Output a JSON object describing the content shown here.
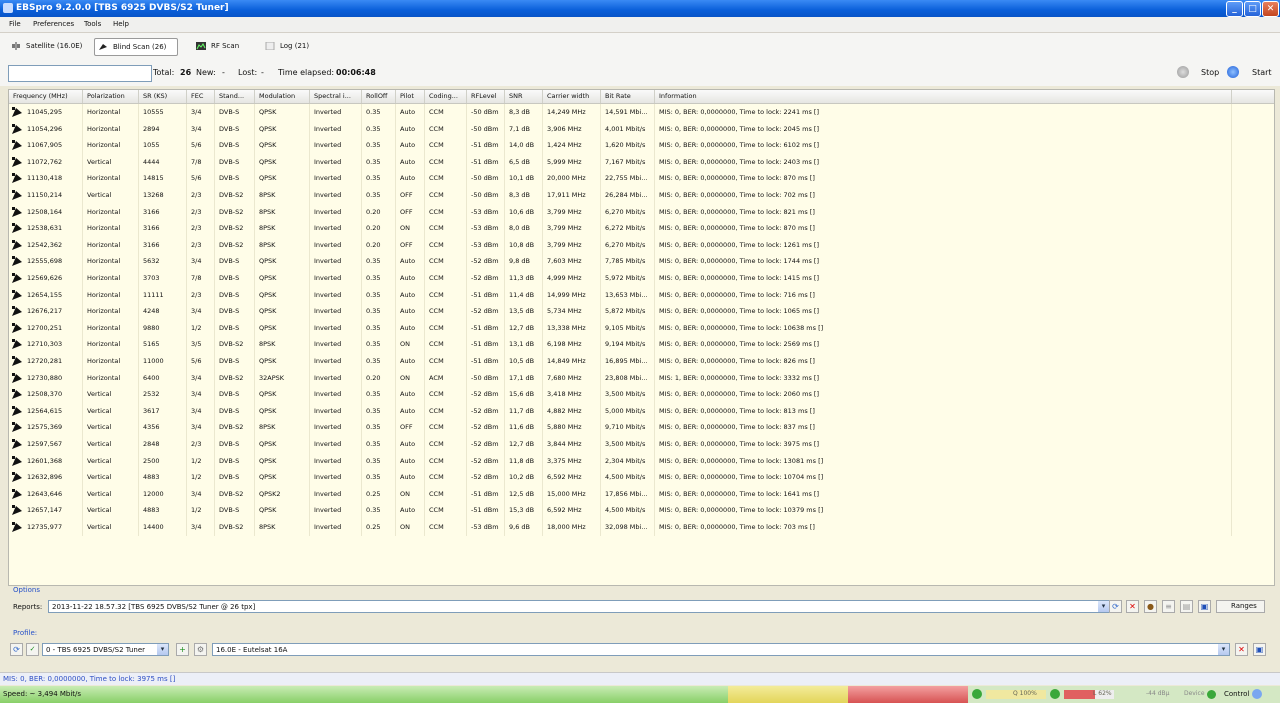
{
  "window": {
    "title": "EBSpro 9.2.0.0 [TBS 6925 DVBS/S2 Tuner]",
    "minimize": "_",
    "maximize": "□",
    "close": "✕"
  },
  "menu": [
    "File",
    "Preferences",
    "Tools",
    "Help"
  ],
  "tabs": [
    {
      "label": "Satellite (16.0E)"
    },
    {
      "label": "Blind Scan (26)"
    },
    {
      "label": "RF Scan"
    },
    {
      "label": "Log (21)"
    }
  ],
  "status": {
    "search_value": "",
    "total_label": "Total:",
    "total_value": "26",
    "new_label": "New:",
    "new_value": "-",
    "lost_label": "Lost:",
    "lost_value": "-",
    "elapsed_label": "Time elapsed:",
    "elapsed_value": "00:06:48",
    "stop_label": "Stop",
    "start_label": "Start"
  },
  "table": {
    "columns": [
      "Frequency (MHz)",
      "Polarization",
      "SR (KS)",
      "FEC",
      "Stand...",
      "Modulation",
      "Spectral i...",
      "RollOff",
      "Pilot",
      "Coding...",
      "RFLevel",
      "SNR",
      "Carrier width",
      "Bit Rate",
      "Information"
    ],
    "rows": [
      [
        "11045,295",
        "Horizontal",
        "10555",
        "3/4",
        "DVB-S",
        "QPSK",
        "Inverted",
        "0.35",
        "Auto",
        "CCM",
        "-50 dBm",
        "8,3 dB",
        "14,249 MHz",
        "14,591 Mbi...",
        "MIS: 0, BER: 0,0000000, Time to lock: 2241 ms []"
      ],
      [
        "11054,296",
        "Horizontal",
        "2894",
        "3/4",
        "DVB-S",
        "QPSK",
        "Inverted",
        "0.35",
        "Auto",
        "CCM",
        "-50 dBm",
        "7,1 dB",
        "3,906 MHz",
        "4,001 Mbit/s",
        "MIS: 0, BER: 0,0000000, Time to lock: 2045 ms []"
      ],
      [
        "11067,905",
        "Horizontal",
        "1055",
        "5/6",
        "DVB-S",
        "QPSK",
        "Inverted",
        "0.35",
        "Auto",
        "CCM",
        "-51 dBm",
        "14,0 dB",
        "1,424 MHz",
        "1,620 Mbit/s",
        "MIS: 0, BER: 0,0000000, Time to lock: 6102 ms []"
      ],
      [
        "11072,762",
        "Vertical",
        "4444",
        "7/8",
        "DVB-S",
        "QPSK",
        "Inverted",
        "0.35",
        "Auto",
        "CCM",
        "-51 dBm",
        "6,5 dB",
        "5,999 MHz",
        "7,167 Mbit/s",
        "MIS: 0, BER: 0,0000000, Time to lock: 2403 ms []"
      ],
      [
        "11130,418",
        "Horizontal",
        "14815",
        "5/6",
        "DVB-S",
        "QPSK",
        "Inverted",
        "0.35",
        "Auto",
        "CCM",
        "-50 dBm",
        "10,1 dB",
        "20,000 MHz",
        "22,755 Mbi...",
        "MIS: 0, BER: 0,0000000, Time to lock: 870 ms []"
      ],
      [
        "11150,214",
        "Vertical",
        "13268",
        "2/3",
        "DVB-S2",
        "8PSK",
        "Inverted",
        "0.35",
        "OFF",
        "CCM",
        "-50 dBm",
        "8,3 dB",
        "17,911 MHz",
        "26,284 Mbi...",
        "MIS: 0, BER: 0,0000000, Time to lock: 702 ms []"
      ],
      [
        "12508,164",
        "Horizontal",
        "3166",
        "2/3",
        "DVB-S2",
        "8PSK",
        "Inverted",
        "0.20",
        "OFF",
        "CCM",
        "-53 dBm",
        "10,6 dB",
        "3,799 MHz",
        "6,270 Mbit/s",
        "MIS: 0, BER: 0,0000000, Time to lock: 821 ms []"
      ],
      [
        "12538,631",
        "Horizontal",
        "3166",
        "2/3",
        "DVB-S2",
        "8PSK",
        "Inverted",
        "0.20",
        "ON",
        "CCM",
        "-53 dBm",
        "8,0 dB",
        "3,799 MHz",
        "6,272 Mbit/s",
        "MIS: 0, BER: 0,0000000, Time to lock: 870 ms []"
      ],
      [
        "12542,362",
        "Horizontal",
        "3166",
        "2/3",
        "DVB-S2",
        "8PSK",
        "Inverted",
        "0.20",
        "OFF",
        "CCM",
        "-53 dBm",
        "10,8 dB",
        "3,799 MHz",
        "6,270 Mbit/s",
        "MIS: 0, BER: 0,0000000, Time to lock: 1261 ms []"
      ],
      [
        "12555,698",
        "Horizontal",
        "5632",
        "3/4",
        "DVB-S",
        "QPSK",
        "Inverted",
        "0.35",
        "Auto",
        "CCM",
        "-52 dBm",
        "9,8 dB",
        "7,603 MHz",
        "7,785 Mbit/s",
        "MIS: 0, BER: 0,0000000, Time to lock: 1744 ms []"
      ],
      [
        "12569,626",
        "Horizontal",
        "3703",
        "7/8",
        "DVB-S",
        "QPSK",
        "Inverted",
        "0.35",
        "Auto",
        "CCM",
        "-52 dBm",
        "11,3 dB",
        "4,999 MHz",
        "5,972 Mbit/s",
        "MIS: 0, BER: 0,0000000, Time to lock: 1415 ms []"
      ],
      [
        "12654,155",
        "Horizontal",
        "11111",
        "2/3",
        "DVB-S",
        "QPSK",
        "Inverted",
        "0.35",
        "Auto",
        "CCM",
        "-51 dBm",
        "11,4 dB",
        "14,999 MHz",
        "13,653 Mbi...",
        "MIS: 0, BER: 0,0000000, Time to lock: 716 ms []"
      ],
      [
        "12676,217",
        "Horizontal",
        "4248",
        "3/4",
        "DVB-S",
        "QPSK",
        "Inverted",
        "0.35",
        "Auto",
        "CCM",
        "-52 dBm",
        "13,5 dB",
        "5,734 MHz",
        "5,872 Mbit/s",
        "MIS: 0, BER: 0,0000000, Time to lock: 1065 ms []"
      ],
      [
        "12700,251",
        "Horizontal",
        "9880",
        "1/2",
        "DVB-S",
        "QPSK",
        "Inverted",
        "0.35",
        "Auto",
        "CCM",
        "-51 dBm",
        "12,7 dB",
        "13,338 MHz",
        "9,105 Mbit/s",
        "MIS: 0, BER: 0,0000000, Time to lock: 10638 ms []"
      ],
      [
        "12710,303",
        "Horizontal",
        "5165",
        "3/5",
        "DVB-S2",
        "8PSK",
        "Inverted",
        "0.35",
        "ON",
        "CCM",
        "-51 dBm",
        "13,1 dB",
        "6,198 MHz",
        "9,194 Mbit/s",
        "MIS: 0, BER: 0,0000000, Time to lock: 2569 ms []"
      ],
      [
        "12720,281",
        "Horizontal",
        "11000",
        "5/6",
        "DVB-S",
        "QPSK",
        "Inverted",
        "0.35",
        "Auto",
        "CCM",
        "-51 dBm",
        "10,5 dB",
        "14,849 MHz",
        "16,895 Mbi...",
        "MIS: 0, BER: 0,0000000, Time to lock: 826 ms []"
      ],
      [
        "12730,880",
        "Horizontal",
        "6400",
        "3/4",
        "DVB-S2",
        "32APSK",
        "Inverted",
        "0.20",
        "ON",
        "ACM",
        "-50 dBm",
        "17,1 dB",
        "7,680 MHz",
        "23,808 Mbi...",
        "MIS: 1, BER: 0,0000000, Time to lock: 3332 ms []"
      ],
      [
        "12508,370",
        "Vertical",
        "2532",
        "3/4",
        "DVB-S",
        "QPSK",
        "Inverted",
        "0.35",
        "Auto",
        "CCM",
        "-52 dBm",
        "15,6 dB",
        "3,418 MHz",
        "3,500 Mbit/s",
        "MIS: 0, BER: 0,0000000, Time to lock: 2060 ms []"
      ],
      [
        "12564,615",
        "Vertical",
        "3617",
        "3/4",
        "DVB-S",
        "QPSK",
        "Inverted",
        "0.35",
        "Auto",
        "CCM",
        "-52 dBm",
        "11,7 dB",
        "4,882 MHz",
        "5,000 Mbit/s",
        "MIS: 0, BER: 0,0000000, Time to lock: 813 ms []"
      ],
      [
        "12575,369",
        "Vertical",
        "4356",
        "3/4",
        "DVB-S2",
        "8PSK",
        "Inverted",
        "0.35",
        "OFF",
        "CCM",
        "-52 dBm",
        "11,6 dB",
        "5,880 MHz",
        "9,710 Mbit/s",
        "MIS: 0, BER: 0,0000000, Time to lock: 837 ms []"
      ],
      [
        "12597,567",
        "Vertical",
        "2848",
        "2/3",
        "DVB-S",
        "QPSK",
        "Inverted",
        "0.35",
        "Auto",
        "CCM",
        "-52 dBm",
        "12,7 dB",
        "3,844 MHz",
        "3,500 Mbit/s",
        "MIS: 0, BER: 0,0000000, Time to lock: 3975 ms []"
      ],
      [
        "12601,368",
        "Vertical",
        "2500",
        "1/2",
        "DVB-S",
        "QPSK",
        "Inverted",
        "0.35",
        "Auto",
        "CCM",
        "-52 dBm",
        "11,8 dB",
        "3,375 MHz",
        "2,304 Mbit/s",
        "MIS: 0, BER: 0,0000000, Time to lock: 13081 ms []"
      ],
      [
        "12632,896",
        "Vertical",
        "4883",
        "1/2",
        "DVB-S",
        "QPSK",
        "Inverted",
        "0.35",
        "Auto",
        "CCM",
        "-52 dBm",
        "10,2 dB",
        "6,592 MHz",
        "4,500 Mbit/s",
        "MIS: 0, BER: 0,0000000, Time to lock: 10704 ms []"
      ],
      [
        "12643,646",
        "Vertical",
        "12000",
        "3/4",
        "DVB-S2",
        "QPSK2",
        "Inverted",
        "0.25",
        "ON",
        "CCM",
        "-51 dBm",
        "12,5 dB",
        "15,000 MHz",
        "17,856 Mbi...",
        "MIS: 0, BER: 0,0000000, Time to lock: 1641 ms []"
      ],
      [
        "12657,147",
        "Vertical",
        "4883",
        "1/2",
        "DVB-S",
        "QPSK",
        "Inverted",
        "0.35",
        "Auto",
        "CCM",
        "-51 dBm",
        "15,3 dB",
        "6,592 MHz",
        "4,500 Mbit/s",
        "MIS: 0, BER: 0,0000000, Time to lock: 10379 ms []"
      ],
      [
        "12735,977",
        "Vertical",
        "14400",
        "3/4",
        "DVB-S2",
        "8PSK",
        "Inverted",
        "0.25",
        "ON",
        "CCM",
        "-53 dBm",
        "9,6 dB",
        "18,000 MHz",
        "32,098 Mbi...",
        "MIS: 0, BER: 0,0000000, Time to lock: 703 ms []"
      ]
    ]
  },
  "options": {
    "label": "Options",
    "reports_label": "Reports:",
    "reports_value": "2013-11-22 18.57.32 [TBS 6925 DVBS/S2 Tuner @ 26 tpx]",
    "ranges_label": "Ranges"
  },
  "profile": {
    "label": "Profile:",
    "tuner_value": "0 - TBS 6925 DVBS/S2 Tuner",
    "satellite_value": "16.0E - Eutelsat 16A"
  },
  "message": "MIS: 0, BER: 0,0000000, Time to lock: 3975 ms []",
  "speedbar": {
    "speed": "Speed: ~ 3,494 Mbit/s",
    "q_value": "Q 100%",
    "l_value": "L 62%",
    "dbm_value": "-44 dBµ",
    "device_label": "Device",
    "control_label": "Control"
  },
  "colors": {
    "accent": "#2d4ec4",
    "titlebar": "#0a5fd9",
    "table_bg": "#fffde8"
  }
}
